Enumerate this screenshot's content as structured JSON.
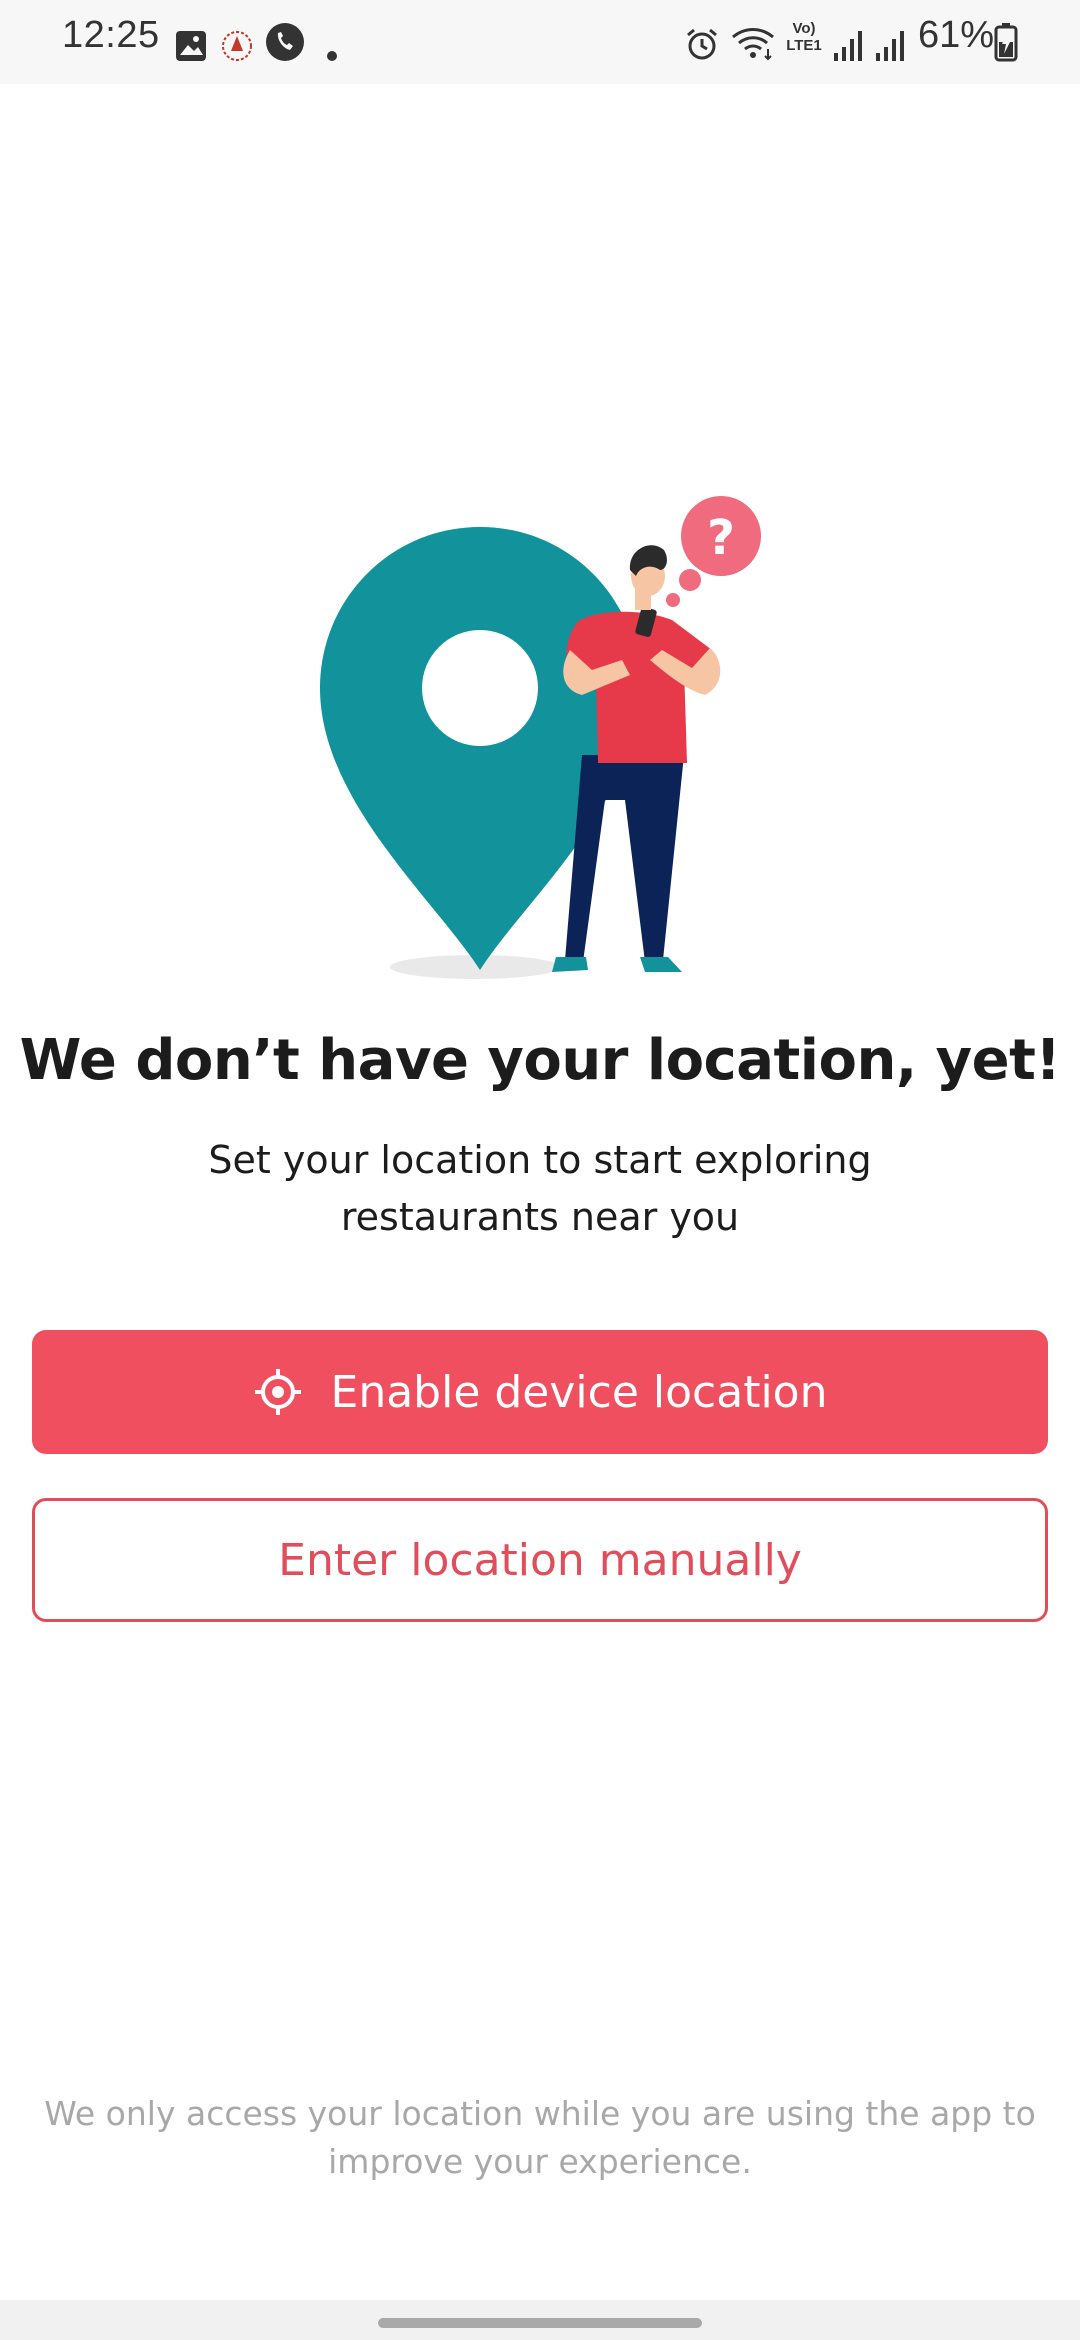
{
  "status_bar": {
    "time": "12:25",
    "battery_percent": "61%",
    "icons": [
      "gallery-icon",
      "app-notification-icon",
      "phone-call-icon",
      "dot-icon",
      "alarm-icon",
      "wifi-icon",
      "volte-icon",
      "signal-icon",
      "signal-icon",
      "battery-charging-icon"
    ],
    "volte_label_top": "Vo)",
    "volte_label_bottom": "LTE1"
  },
  "illustration": {
    "question_mark": "?",
    "colors": {
      "pin": "#12929a",
      "shirt": "#e63a4a",
      "pants": "#0b2357",
      "bubble": "#f06b7d",
      "skin": "#f6c5a3"
    }
  },
  "content": {
    "heading": "We don’t have your location, yet!",
    "subheading": "Set your location to start exploring restaurants near you"
  },
  "actions": {
    "primary_label": "Enable device location",
    "primary_icon": "locate-target-icon",
    "secondary_label": "Enter location manually",
    "accent_color": "#ef4f5f"
  },
  "footer": {
    "note": "We only access your location while you are using the app to improve your experience."
  }
}
